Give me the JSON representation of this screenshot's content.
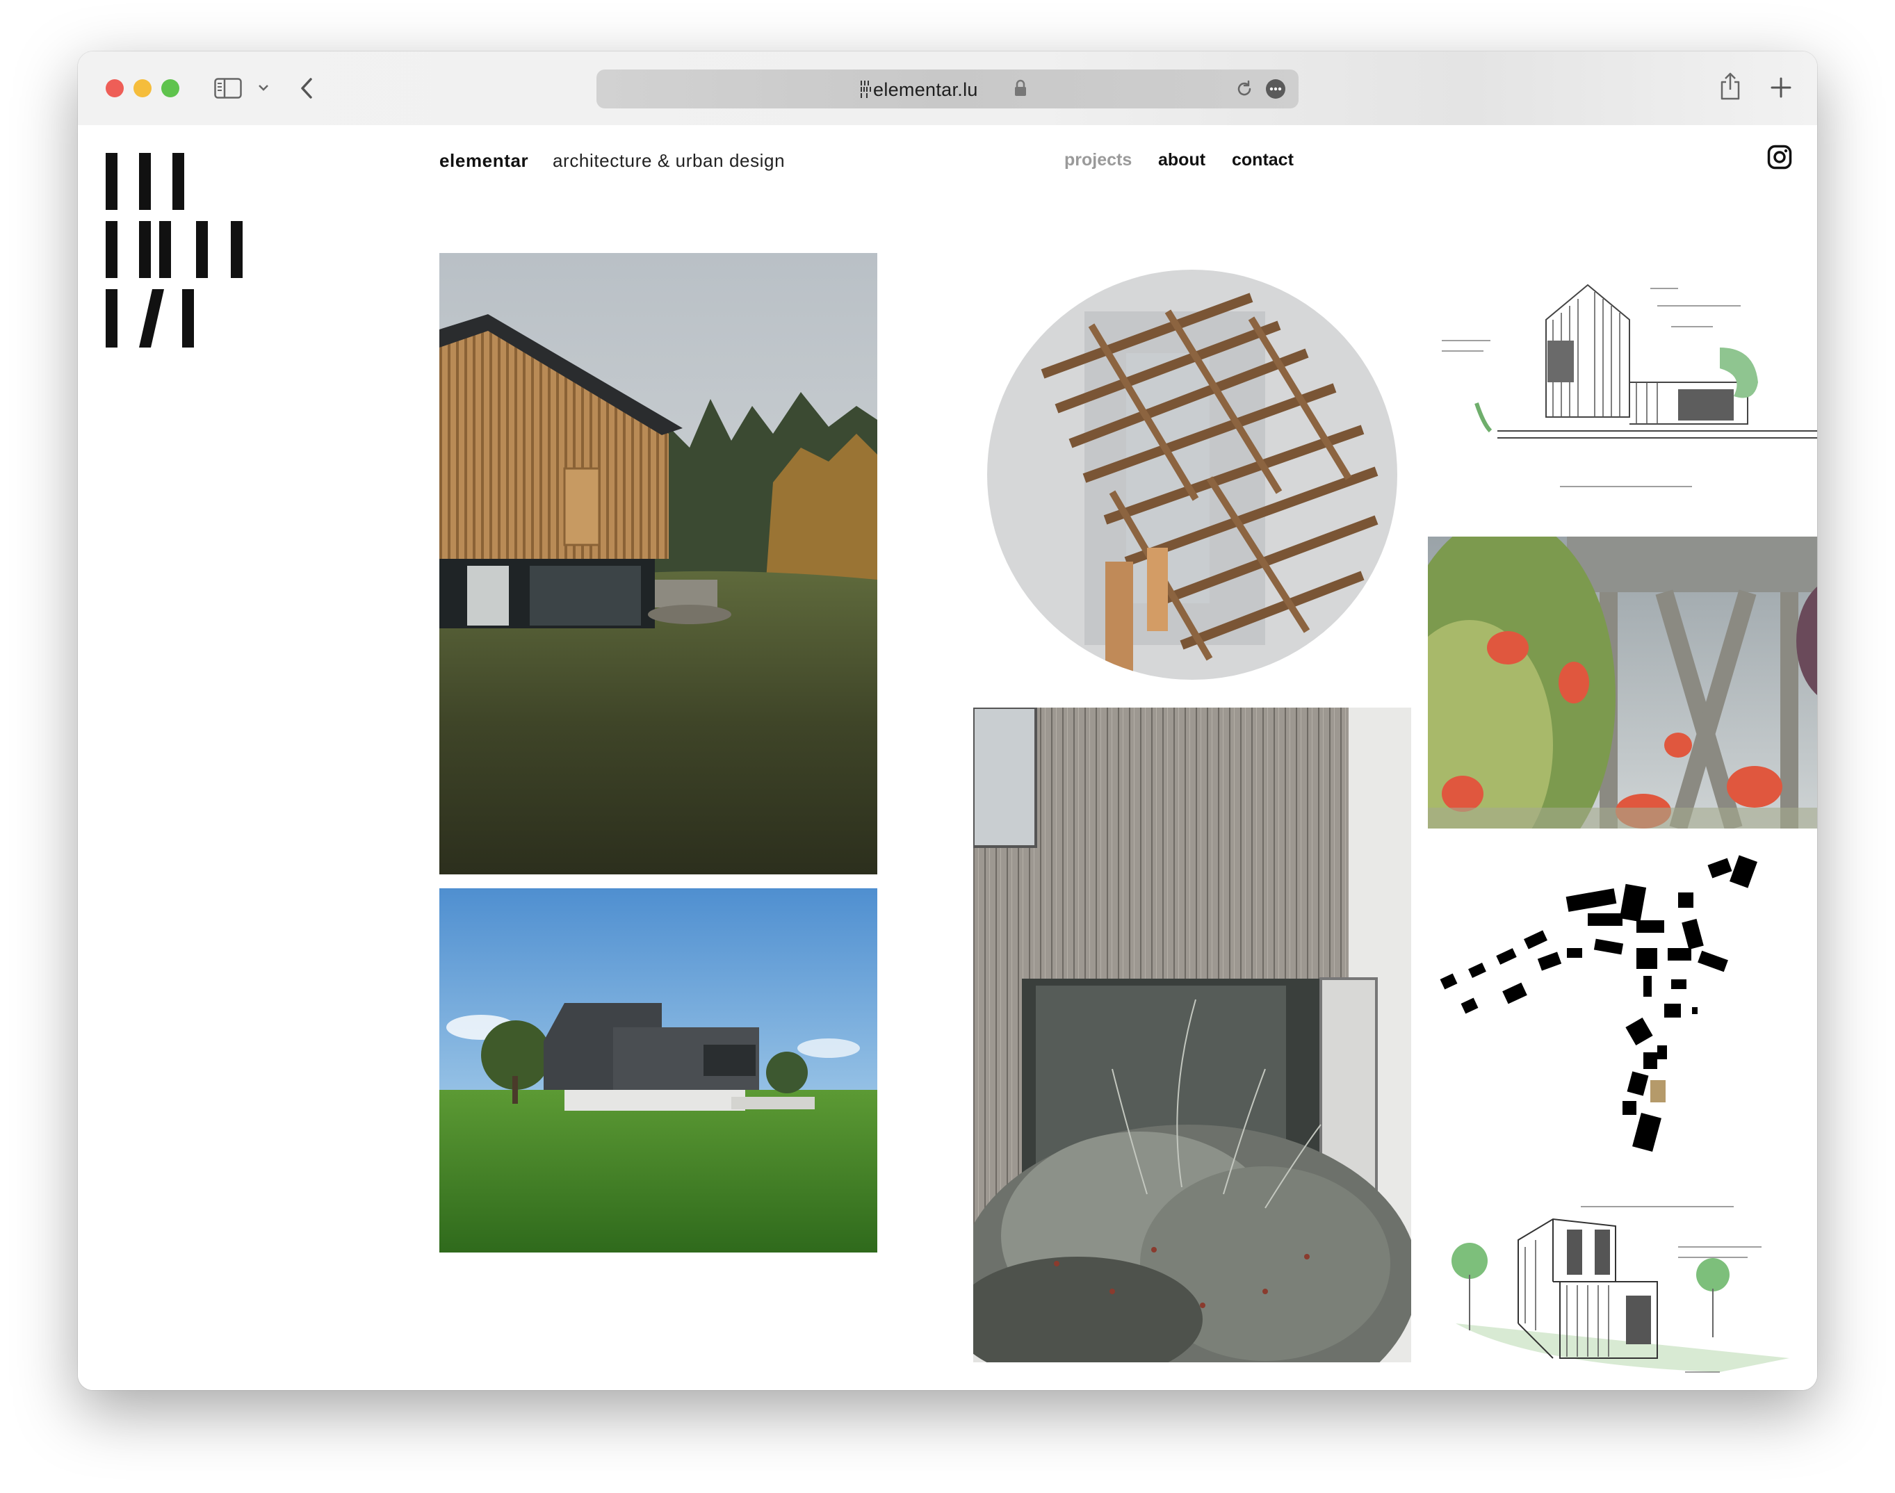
{
  "browser": {
    "url": "elementar.lu"
  },
  "site": {
    "brand": "elementar",
    "tagline": "architecture & urban design"
  },
  "nav": {
    "items": [
      {
        "label": "projects",
        "active": false
      },
      {
        "label": "about",
        "active": true
      },
      {
        "label": "contact",
        "active": true
      }
    ]
  },
  "icons": {
    "sidebar": "sidebar-icon",
    "back": "chevron-left-icon",
    "share": "share-icon",
    "new_tab": "plus-icon",
    "reload": "reload-icon",
    "more": "more-icon",
    "lock": "lock-icon",
    "instagram": "instagram-icon"
  },
  "colors": {
    "traffic_red": "#ee5e57",
    "traffic_yellow": "#f5bd3c",
    "traffic_green": "#5fc34d",
    "nav_inactive": "#9a9a9a"
  }
}
